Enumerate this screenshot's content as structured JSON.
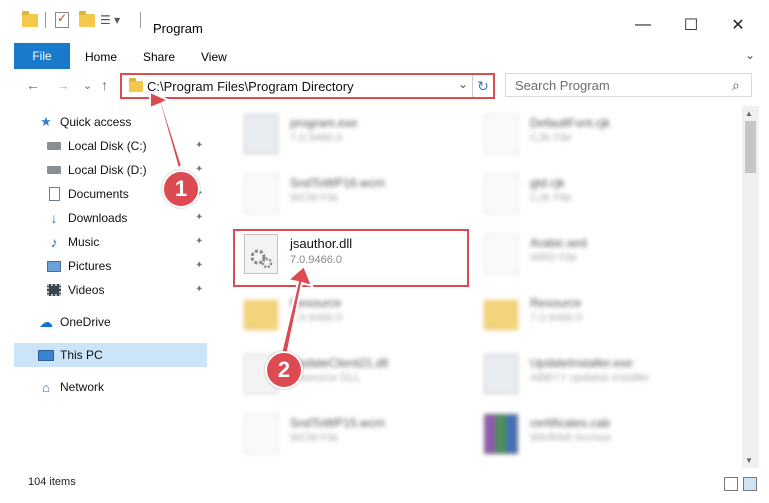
{
  "window": {
    "title": "Program",
    "minimize_glyph": "—",
    "maximize_glyph": "☐",
    "close_glyph": "✕"
  },
  "ribbon": {
    "file_tab": "File",
    "tabs": [
      "Home",
      "Share",
      "View"
    ],
    "expand_glyph": "⌄",
    "help_glyph": "?"
  },
  "address_bar": {
    "back_glyph": "←",
    "forward_glyph": "→",
    "recent_glyph": "⌄",
    "up_glyph": "↑",
    "path": "C:\\Program Files\\Program Directory",
    "dropdown_glyph": "⌄",
    "refresh_glyph": "↻"
  },
  "search": {
    "placeholder": "Search Program",
    "icon_glyph": "⌕"
  },
  "nav_pane": {
    "items": [
      {
        "label": "Quick access",
        "icon": "star-icon"
      },
      {
        "label": "Local Disk (C:)",
        "icon": "drive-icon",
        "pinned": true
      },
      {
        "label": "Local Disk (D:)",
        "icon": "drive-icon",
        "pinned": true
      },
      {
        "label": "Documents",
        "icon": "documents-icon",
        "pinned": true
      },
      {
        "label": "Downloads",
        "icon": "download-icon",
        "pinned": true
      },
      {
        "label": "Music",
        "icon": "music-icon",
        "pinned": true
      },
      {
        "label": "Pictures",
        "icon": "pictures-icon",
        "pinned": true
      },
      {
        "label": "Videos",
        "icon": "videos-icon",
        "pinned": true
      },
      {
        "label": "OneDrive",
        "icon": "onedrive-icon"
      },
      {
        "label": "This PC",
        "icon": "this-pc-icon",
        "selected": true
      },
      {
        "label": "Network",
        "icon": "network-icon"
      }
    ],
    "pin_glyph": "📌"
  },
  "files": [
    {
      "name": "program.exe",
      "meta": "7.0.9466.0",
      "type": "exe",
      "blurred": true
    },
    {
      "name": "DefaultFont.cjk",
      "meta": "CJK File",
      "type": "doc",
      "blurred": true
    },
    {
      "name": "SndToWP16.wcm",
      "meta": "WCM File",
      "type": "doc",
      "blurred": true
    },
    {
      "name": "gtd.cjk",
      "meta": "CJK File",
      "type": "doc",
      "blurred": true
    },
    {
      "name": "jsauthor.dll",
      "meta": "7.0.9466.0",
      "type": "dll",
      "blurred": false
    },
    {
      "name": "Arabic.wrd",
      "meta": "WRD File",
      "type": "doc",
      "blurred": true
    },
    {
      "name": "Resource",
      "meta": "7.0.9466.0",
      "type": "folder",
      "blurred": true
    },
    {
      "name": "Resource",
      "meta": "7.0.9466.0",
      "type": "folder",
      "blurred": true
    },
    {
      "name": "UpdateClient21.dll",
      "meta": "Resource DLL",
      "type": "dll",
      "blurred": true
    },
    {
      "name": "UpdateInstaller.exe",
      "meta": "ABBYY updates installer",
      "type": "exe",
      "blurred": true
    },
    {
      "name": "SndToWP15.wcm",
      "meta": "WCM File",
      "type": "doc",
      "blurred": true
    },
    {
      "name": "certificates.cab",
      "meta": "WinRAR Archive",
      "type": "cab",
      "blurred": true
    }
  ],
  "status": {
    "item_count": "104 items"
  },
  "callouts": [
    "1",
    "2"
  ],
  "colors": {
    "accent": "#1979ca",
    "highlight": "#dc4a52",
    "selection": "#cce4f7"
  }
}
